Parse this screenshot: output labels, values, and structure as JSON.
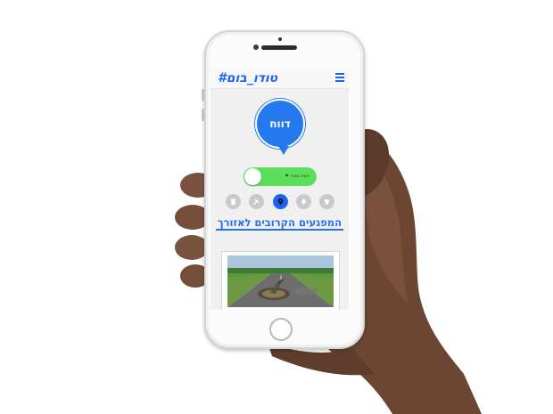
{
  "app": {
    "logo_text": "#טודו_בום",
    "menu_icon": "hamburger-menu-icon"
  },
  "report_button": {
    "label": "דווח"
  },
  "toggle": {
    "label": "⚑ המה ממה",
    "state_on": true
  },
  "filter_icons": [
    "trash-icon",
    "tools-icon",
    "location-pin-icon",
    "leaf-icon",
    "shirt-icon"
  ],
  "section": {
    "title": "המפגעים הקרובים לאזורך"
  },
  "card": {
    "image": "road-pothole-crocodile-photo"
  },
  "colors": {
    "brand_blue": "#1b63f2",
    "toggle_green": "#5ce05c",
    "inactive_gray": "#c9c9c9"
  }
}
